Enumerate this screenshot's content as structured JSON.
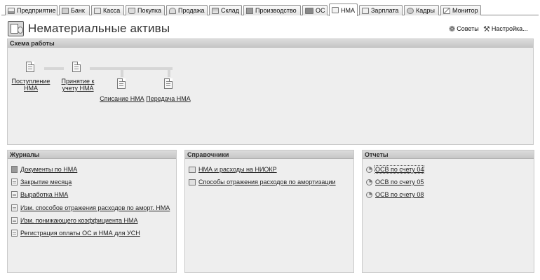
{
  "tabs": [
    {
      "label": "Предприятие",
      "icon": "factory-icon",
      "active": false
    },
    {
      "label": "Банк",
      "icon": "bank-icon",
      "active": false
    },
    {
      "label": "Касса",
      "icon": "cash-register-icon",
      "active": false
    },
    {
      "label": "Покупка",
      "icon": "purchase-icon",
      "active": false
    },
    {
      "label": "Продажа",
      "icon": "sale-icon",
      "active": false
    },
    {
      "label": "Склад",
      "icon": "warehouse-icon",
      "active": false
    },
    {
      "label": "Производство",
      "icon": "production-icon",
      "active": false
    },
    {
      "label": "ОС",
      "icon": "fixed-assets-icon",
      "active": false
    },
    {
      "label": "НМА",
      "icon": "intangible-assets-icon",
      "active": true
    },
    {
      "label": "Зарплата",
      "icon": "salary-icon",
      "active": false
    },
    {
      "label": "Кадры",
      "icon": "staff-icon",
      "active": false
    },
    {
      "label": "Монитор",
      "icon": "monitor-icon",
      "active": false
    }
  ],
  "header": {
    "title": "Нематериальные активы",
    "icon": "intangible-assets-icon",
    "tips_label": "Советы",
    "settings_label": "Настройка..."
  },
  "scheme": {
    "title": "Схема работы",
    "nodes": [
      {
        "label": "Поступление НМА"
      },
      {
        "label": "Принятие к учету НМА"
      },
      {
        "label": "Списание НМА"
      },
      {
        "label": "Передача НМА"
      }
    ]
  },
  "journals": {
    "title": "Журналы",
    "items": [
      {
        "label": "Документы по НМА",
        "icon": "journal-icon"
      },
      {
        "label": "Закрытие месяца",
        "icon": "document-icon"
      },
      {
        "label": "Выработка НМА",
        "icon": "document-icon"
      },
      {
        "label": "Изм. способов отражения расходов по аморт. НМА",
        "icon": "document-icon"
      },
      {
        "label": "Изм. понижающего коэффициента НМА",
        "icon": "document-icon"
      },
      {
        "label": "Регистрация оплаты ОС и НМА для УСН",
        "icon": "document-icon"
      }
    ]
  },
  "references": {
    "title": "Справочники",
    "items": [
      {
        "label": "НМА и расходы на НИОКР",
        "icon": "catalog-icon"
      },
      {
        "label": "Способы отражения расходов по амортизации",
        "icon": "catalog-icon"
      }
    ]
  },
  "reports": {
    "title": "Отчеты",
    "items": [
      {
        "label": "ОСВ по счету 04",
        "icon": "report-icon"
      },
      {
        "label": "ОСВ по счету 05",
        "icon": "report-icon"
      },
      {
        "label": "ОСВ по счету 08",
        "icon": "report-icon"
      }
    ]
  }
}
